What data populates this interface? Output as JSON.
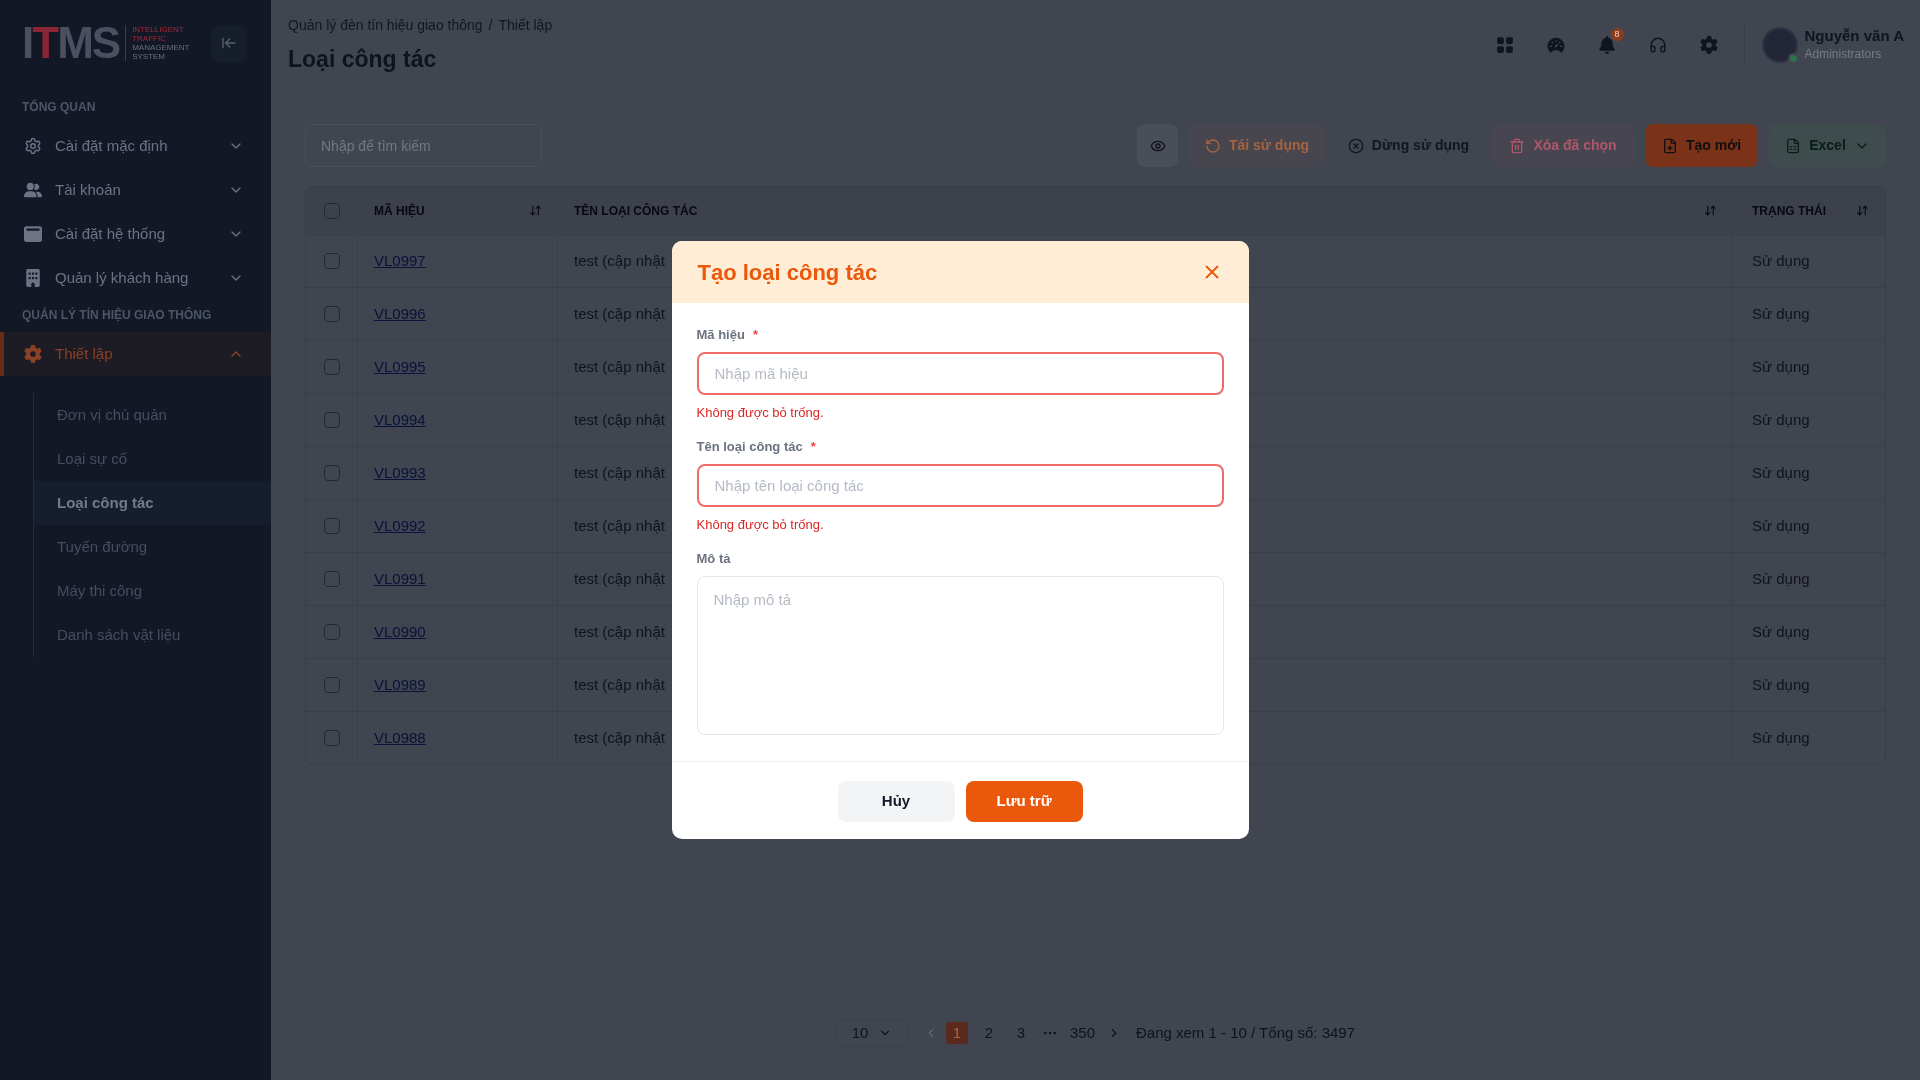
{
  "sidebar": {
    "logo": {
      "mark": "ITMS",
      "tagline": [
        {
          "text": "INTELLIGENT",
          "kind": "accent"
        },
        {
          "text": "TRAFFIC",
          "kind": "accent"
        },
        {
          "text": "MANAGEMENT",
          "kind": "plain"
        },
        {
          "text": "SYSTEM",
          "kind": "plain"
        }
      ]
    },
    "sections": [
      {
        "title": "TỔNG QUAN",
        "items": [
          {
            "label": "Cài đặt mặc định",
            "selected": false,
            "expanded": false
          },
          {
            "label": "Tài khoản",
            "selected": false,
            "expanded": false
          },
          {
            "label": "Cài đặt hệ thống",
            "selected": false,
            "expanded": false
          },
          {
            "label": "Quản lý khách hàng",
            "selected": false,
            "expanded": false
          }
        ]
      },
      {
        "title": "QUẢN LÝ TÍN HIỆU GIAO THÔNG",
        "items": [
          {
            "label": "Thiết lập",
            "selected": true,
            "expanded": true,
            "children": [
              {
                "label": "Đơn vị chủ quản",
                "selected": false
              },
              {
                "label": "Loại sự cố",
                "selected": false
              },
              {
                "label": "Loại công tác",
                "selected": true
              },
              {
                "label": "Tuyến đường",
                "selected": false
              },
              {
                "label": "Máy thi công",
                "selected": false
              },
              {
                "label": "Danh sách vật liệu",
                "selected": false
              }
            ]
          }
        ]
      }
    ]
  },
  "header": {
    "breadcrumb": {
      "items": [
        "Quản lý đèn tín hiệu giao thông",
        "Thiết lập"
      ],
      "separator": "/"
    },
    "title": "Loại công tác",
    "notifications": "8",
    "user": {
      "name": "Nguyễn văn A",
      "role": "Administrators",
      "online": true
    }
  },
  "toolbar": {
    "search": {
      "placeholder": "Nhập để tìm kiếm"
    },
    "buttons": [
      {
        "kind": "view"
      },
      {
        "kind": "reuse",
        "label": "Tái sử dụng",
        "disabled": true
      },
      {
        "kind": "stop",
        "label": "Dừng sử dụng",
        "disabled": false
      },
      {
        "kind": "delete",
        "label": "Xóa đã chọn",
        "disabled": true
      },
      {
        "kind": "create",
        "label": "Tạo mới",
        "disabled": false
      },
      {
        "kind": "export",
        "label": "Excel",
        "disabled": false
      }
    ]
  },
  "table": {
    "columns": [
      {
        "kind": "checkbox",
        "checked": false
      },
      {
        "kind": "text",
        "label": "MÃ HIỆU",
        "sortable": true
      },
      {
        "kind": "text",
        "label": "TÊN LOẠI CÔNG TÁC",
        "sortable": true
      },
      {
        "kind": "text",
        "label": "TRẠNG THÁI",
        "sortable": true
      }
    ],
    "rows": [
      {
        "checked": false,
        "code": "VL0997",
        "name": "test (cập nhật",
        "status": "Sử dụng"
      },
      {
        "checked": false,
        "code": "VL0996",
        "name": "test (cập nhật",
        "status": "Sử dụng"
      },
      {
        "checked": false,
        "code": "VL0995",
        "name": "test (cập nhật",
        "status": "Sử dụng"
      },
      {
        "checked": false,
        "code": "VL0994",
        "name": "test (cập nhật",
        "status": "Sử dụng"
      },
      {
        "checked": false,
        "code": "VL0993",
        "name": "test (cập nhật",
        "status": "Sử dụng"
      },
      {
        "checked": false,
        "code": "VL0992",
        "name": "test (cập nhật",
        "status": "Sử dụng"
      },
      {
        "checked": false,
        "code": "VL0991",
        "name": "test (cập nhật",
        "status": "Sử dụng"
      },
      {
        "checked": false,
        "code": "VL0990",
        "name": "test (cập nhật",
        "status": "Sử dụng"
      },
      {
        "checked": false,
        "code": "VL0989",
        "name": "test (cập nhật",
        "status": "Sử dụng"
      },
      {
        "checked": false,
        "code": "VL0988",
        "name": "test (cập nhật",
        "status": "Sử dụng"
      }
    ]
  },
  "pagination": {
    "page_size": "10",
    "previous": {
      "disabled": true
    },
    "next": {
      "disabled": false
    },
    "pages": [
      {
        "kind": "page",
        "label": "1",
        "selected": true
      },
      {
        "kind": "page",
        "label": "2",
        "selected": false
      },
      {
        "kind": "page",
        "label": "3",
        "selected": false
      },
      {
        "kind": "ellipsis",
        "selected": false
      },
      {
        "kind": "page",
        "label": "350",
        "selected": false
      }
    ],
    "summary": "Đang xem 1 - 10 / Tổng số: 3497"
  },
  "dialog": {
    "title": "Tạo loại công tác",
    "fields": [
      {
        "kind": "input",
        "label": "Mã hiệu",
        "required_mark": "*",
        "placeholder": "Nhập mã hiệu",
        "invalid": true,
        "error": "Không được bỏ trống."
      },
      {
        "kind": "input",
        "label": "Tên loại công tác",
        "required_mark": "*",
        "placeholder": "Nhập tên loại công tác",
        "invalid": true,
        "error": "Không được bỏ trống."
      },
      {
        "kind": "textarea",
        "label": "Mô tả",
        "placeholder": "Nhập mô tả",
        "invalid": false
      }
    ],
    "buttons": [
      {
        "kind": "secondary",
        "label": "Hủy"
      },
      {
        "kind": "primary",
        "label": "Lưu trữ"
      }
    ]
  }
}
